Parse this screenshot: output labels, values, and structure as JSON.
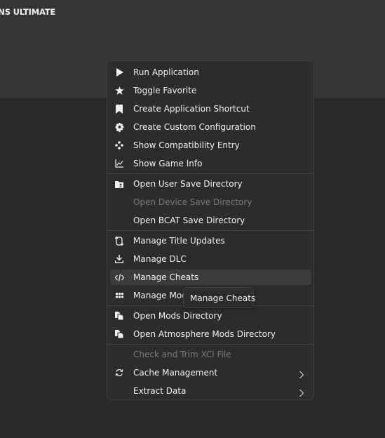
{
  "window": {
    "title_fragment": "TIONS ULTIMATE"
  },
  "context_menu": {
    "groups": [
      [
        {
          "label": "Run Application",
          "icon": "play-icon",
          "enabled": true
        },
        {
          "label": "Toggle Favorite",
          "icon": "star-icon",
          "enabled": true
        },
        {
          "label": "Create Application Shortcut",
          "icon": "bookmark-icon",
          "enabled": true
        },
        {
          "label": "Create Custom Configuration",
          "icon": "gear-icon",
          "enabled": true
        },
        {
          "label": "Show Compatibility Entry",
          "icon": "gamepad-icon",
          "enabled": true
        },
        {
          "label": "Show Game Info",
          "icon": "chart-icon",
          "enabled": true
        }
      ],
      [
        {
          "label": "Open User Save Directory",
          "icon": "user-folder-icon",
          "enabled": true
        },
        {
          "label": "Open Device Save Directory",
          "icon": "",
          "enabled": false
        },
        {
          "label": "Open BCAT Save Directory",
          "icon": "",
          "enabled": true
        }
      ],
      [
        {
          "label": "Manage Title Updates",
          "icon": "sync-icon",
          "enabled": true
        },
        {
          "label": "Manage DLC",
          "icon": "download-icon",
          "enabled": true
        },
        {
          "label": "Manage Cheats",
          "icon": "code-icon",
          "enabled": true,
          "highlighted": true
        },
        {
          "label": "Manage Mods",
          "icon": "grid-icon",
          "enabled": true
        }
      ],
      [
        {
          "label": "Open Mods Directory",
          "icon": "files-icon",
          "enabled": true
        },
        {
          "label": "Open Atmosphere Mods Directory",
          "icon": "files-icon",
          "enabled": true
        }
      ],
      [
        {
          "label": "Check and Trim XCI File",
          "icon": "",
          "enabled": false
        },
        {
          "label": "Cache Management",
          "icon": "refresh-icon",
          "enabled": true,
          "submenu": true
        },
        {
          "label": "Extract Data",
          "icon": "",
          "enabled": true,
          "submenu": true
        }
      ]
    ]
  },
  "tooltip": {
    "text": "Manage Cheats"
  },
  "colors": {
    "menu_bg": "#2c2c2c",
    "highlight": "#3c3c3c",
    "disabled_text": "#7b7b7b"
  }
}
